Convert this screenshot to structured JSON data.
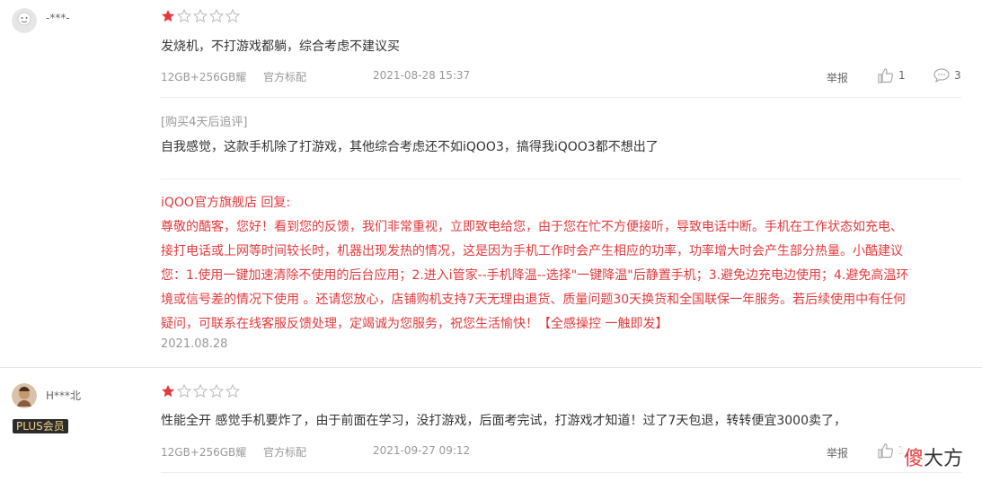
{
  "review1": {
    "user": "-***-",
    "rating": 1,
    "text": "发烧机，不打游戏都躺，综合考虑不建议买",
    "spec": "12GB+256GB耀",
    "config": "官方标配",
    "time": "2021-08-28 15:37",
    "report": "举报",
    "likes": "1",
    "comments": "3",
    "followup_tag": "[购买4天后追评]",
    "followup_text": "自我感觉，这款手机除了打游戏，其他综合考虑还不如iQOO3，搞得我iQOO3都不想出了",
    "reply_title": "iQOO官方旗舰店 回复:",
    "reply_lines": [
      "尊敬的酷客，您好！看到您的反馈，我们非常重视，立即致电给您，由于您在忙不方便接听，导致电话中断。手机在工作状态如充电、",
      "接打电话或上网等时间较长时，机器出现发热的情况，这是因为手机工作时会产生相应的功率，功率增大时会产生部分热量。小酷建议",
      "您：1.使用一键加速清除不使用的后台应用；2.进入i管家--手机降温--选择\"一键降温\"后静置手机；3.避免边充电边使用；4.避免高温环",
      "境或信号差的情况下使用 。还请您放心，店铺购机支持7天无理由退货、质量问题30天换货和全国联保一年服务。若后续使用中有任何",
      "疑问，可联系在线客服反馈处理，定竭诚为您服务，祝您生活愉快！【全感操控 一触即发】"
    ],
    "reply_date": "2021.08.28"
  },
  "review2": {
    "user": "H***北",
    "badge": "PLUS会员",
    "rating": 1,
    "text": "性能全开 感觉手机要炸了，由于前面在学习，没打游戏，后面考完试，打游戏才知道！过了7天包退，转转便宜3000卖了，",
    "spec": "12GB+256GB耀",
    "config": "官方标配",
    "time": "2021-09-27 09:12",
    "report": "举报",
    "likes": "1"
  },
  "watermark": {
    "red": "傻",
    "rest": "大方"
  },
  "colors": {
    "accent": "#e4393c",
    "star_filled": "#e4393c",
    "star_empty": "#bbb"
  }
}
